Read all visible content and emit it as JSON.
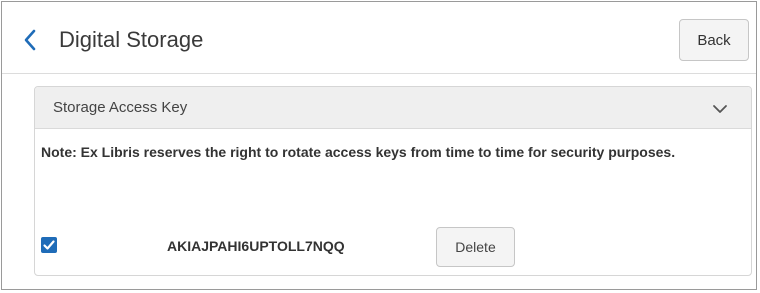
{
  "header": {
    "title": "Digital Storage",
    "back_label": "Back",
    "back_chevron_icon": "chevron-left-icon"
  },
  "section": {
    "title": "Storage Access Key",
    "collapse_icon": "chevron-down-icon",
    "note": "Note: Ex Libris reserves the right to rotate access keys from time to time for security purposes.",
    "key": {
      "checked": true,
      "value": "AKIAJPAHI6UPTOLL7NQQ",
      "delete_label": "Delete"
    }
  },
  "colors": {
    "accent": "#1f6cb8",
    "button_bg": "#f4f4f4",
    "section_header_bg": "#efefef"
  }
}
